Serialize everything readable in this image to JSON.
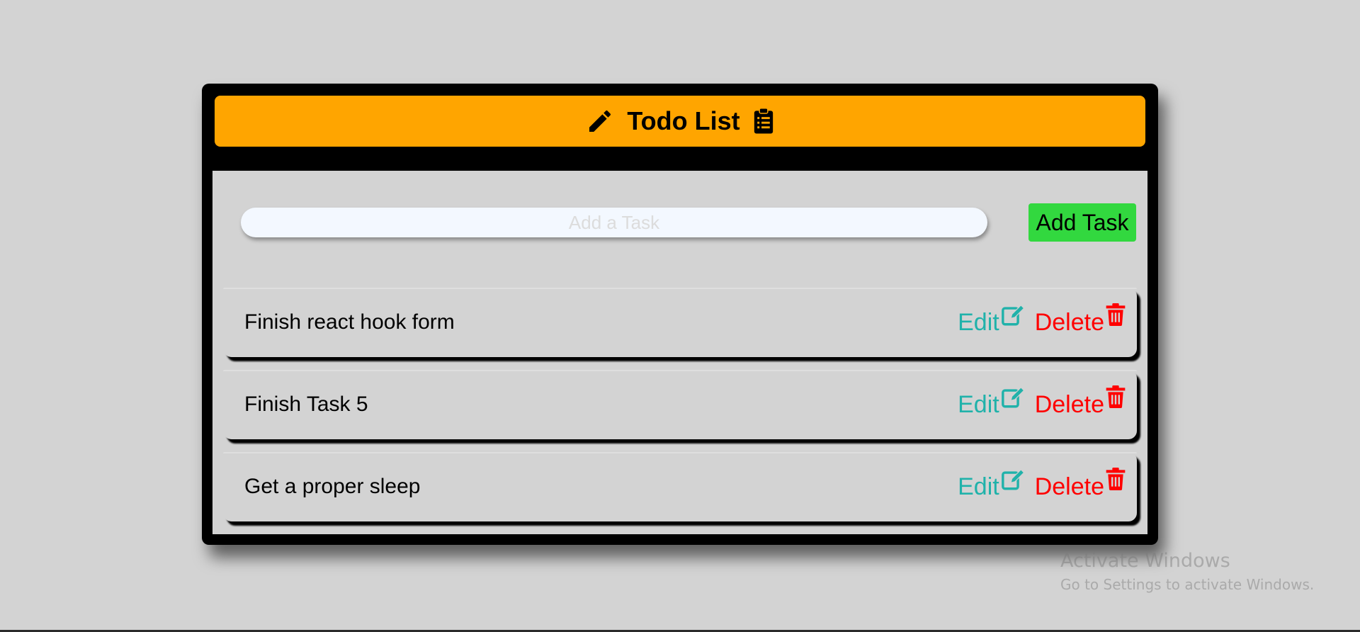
{
  "header": {
    "title": "Todo List",
    "left_icon": "pencil-icon",
    "right_icon": "clipboard-list-icon",
    "background_color": "#ffa500"
  },
  "input": {
    "value": "",
    "placeholder": "Add a Task"
  },
  "add_button": {
    "label": "Add Task",
    "color": "#32d83f"
  },
  "tasks": [
    {
      "text": "Finish react hook form",
      "edit_label": "Edit",
      "delete_label": "Delete"
    },
    {
      "text": "Finish Task 5",
      "edit_label": "Edit",
      "delete_label": "Delete"
    },
    {
      "text": "Get a proper sleep",
      "edit_label": "Edit",
      "delete_label": "Delete"
    }
  ],
  "action_icons": {
    "edit": "edit-square-icon",
    "delete": "trash-icon"
  },
  "colors": {
    "edit": "#20b2aa",
    "delete": "#ff0000"
  },
  "watermark": {
    "title": "Activate Windows",
    "subtitle": "Go to Settings to activate Windows."
  }
}
